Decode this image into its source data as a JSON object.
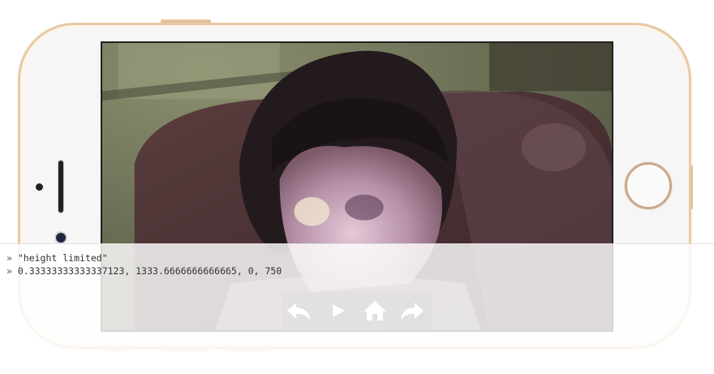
{
  "device": {
    "frame_color": "#e9c9a2",
    "body_color": "#f6f6f7"
  },
  "video": {
    "icon": "video-frame"
  },
  "console": {
    "lines": [
      {
        "prompt": "»",
        "text": " \"height limited\""
      },
      {
        "prompt": "»",
        "text": " 0.33333333333337123, 1333.6666666666665, 0, 750"
      }
    ]
  },
  "controls": {
    "items": [
      {
        "name": "back",
        "icon": "reply-arrow-icon"
      },
      {
        "name": "play",
        "icon": "play-icon"
      },
      {
        "name": "home",
        "icon": "home-icon"
      },
      {
        "name": "forward",
        "icon": "forward-arrow-icon"
      }
    ],
    "icon_color": "#ffffff"
  }
}
